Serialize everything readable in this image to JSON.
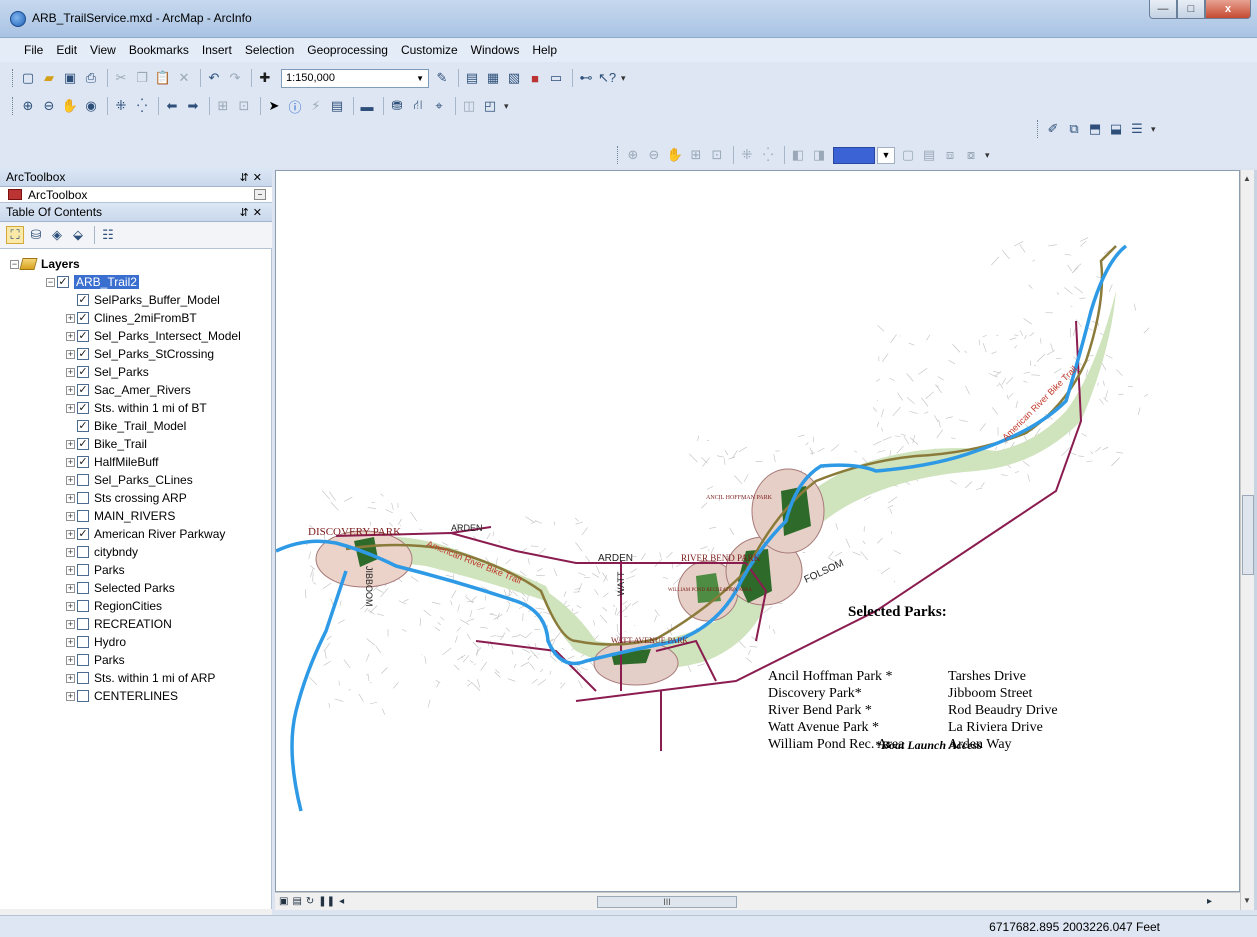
{
  "window": {
    "title": "ARB_TrailService.mxd - ArcMap - ArcInfo",
    "min_label": "—",
    "max_label": "□",
    "close_label": "x"
  },
  "menu": [
    "File",
    "Edit",
    "View",
    "Bookmarks",
    "Insert",
    "Selection",
    "Geoprocessing",
    "Customize",
    "Windows",
    "Help"
  ],
  "toolbar": {
    "scale_value": "1:150,000"
  },
  "arctoolbox": {
    "header": "ArcToolbox",
    "item": "ArcToolbox"
  },
  "toc": {
    "header": "Table Of Contents",
    "root": "Layers",
    "group": "ARB_Trail2",
    "layers": [
      {
        "name": "SelParks_Buffer_Model",
        "checked": true,
        "expandable": false
      },
      {
        "name": "Clines_2miFromBT",
        "checked": true,
        "expandable": true
      },
      {
        "name": "Sel_Parks_Intersect_Model",
        "checked": true,
        "expandable": true
      },
      {
        "name": "Sel_Parks_StCrossing",
        "checked": true,
        "expandable": true
      },
      {
        "name": "Sel_Parks",
        "checked": true,
        "expandable": true
      },
      {
        "name": "Sac_Amer_Rivers",
        "checked": true,
        "expandable": true
      },
      {
        "name": "Sts. within 1 mi of BT",
        "checked": true,
        "expandable": true
      },
      {
        "name": "Bike_Trail_Model",
        "checked": true,
        "expandable": false
      },
      {
        "name": "Bike_Trail",
        "checked": true,
        "expandable": true
      },
      {
        "name": "HalfMileBuff",
        "checked": true,
        "expandable": true
      },
      {
        "name": "Sel_Parks_CLines",
        "checked": false,
        "expandable": true
      },
      {
        "name": "Sts crossing ARP",
        "checked": false,
        "expandable": true
      },
      {
        "name": "MAIN_RIVERS",
        "checked": false,
        "expandable": true
      },
      {
        "name": "American River Parkway",
        "checked": true,
        "expandable": true
      },
      {
        "name": "citybndy",
        "checked": false,
        "expandable": true
      },
      {
        "name": "Parks",
        "checked": false,
        "expandable": true
      },
      {
        "name": "Selected Parks",
        "checked": false,
        "expandable": true
      },
      {
        "name": "RegionCities",
        "checked": false,
        "expandable": true
      },
      {
        "name": "RECREATION",
        "checked": false,
        "expandable": true
      },
      {
        "name": "Hydro",
        "checked": false,
        "expandable": true
      },
      {
        "name": "Parks",
        "checked": false,
        "expandable": true
      },
      {
        "name": "Sts. within 1 mi of ARP",
        "checked": false,
        "expandable": true
      },
      {
        "name": "CENTERLINES",
        "checked": false,
        "expandable": true
      }
    ]
  },
  "map": {
    "labels": {
      "discovery_park": "DISCOVERY PARK",
      "arden_top": "ARDEN",
      "arden": "ARDEN",
      "jibboom": "JIBBOOM",
      "watt": "WATT",
      "river_bend": "RIVER BEND PARK",
      "ancil": "ANCIL HOFFMAN PARK",
      "william_pond": "WILLIAM POND RECREATION AREA",
      "watt_park": "WATT AVENUE PARK",
      "folsom": "FOLSOM",
      "trail_west": "American River Bike Trail",
      "trail_east": "American River Bike Trail"
    },
    "legend": {
      "title": "Selected Parks:",
      "rows": [
        {
          "park": "Ancil Hoffman Park *",
          "access": "Tarshes Drive"
        },
        {
          "park": "Discovery Park*",
          "access": "Jibboom Street"
        },
        {
          "park": "River Bend Park  *",
          "access": "Rod Beaudry Drive"
        },
        {
          "park": "Watt Avenue Park *",
          "access": "La Riviera Drive"
        },
        {
          "park": "William Pond Rec. Area",
          "access": "Arden Way"
        }
      ],
      "footnote": "*Boat Launch Access"
    },
    "colors": {
      "river": "#2e9ae6",
      "trail": "#8b7b3a",
      "road": "#8a1c4f",
      "parkway": "#c7dfb2",
      "park": "#1f6b2a",
      "buffer": "#e8c8c0"
    }
  },
  "scroll": {
    "h_thumb": "III"
  },
  "status": {
    "coordinates": "6717682.895  2003226.047 Feet"
  }
}
